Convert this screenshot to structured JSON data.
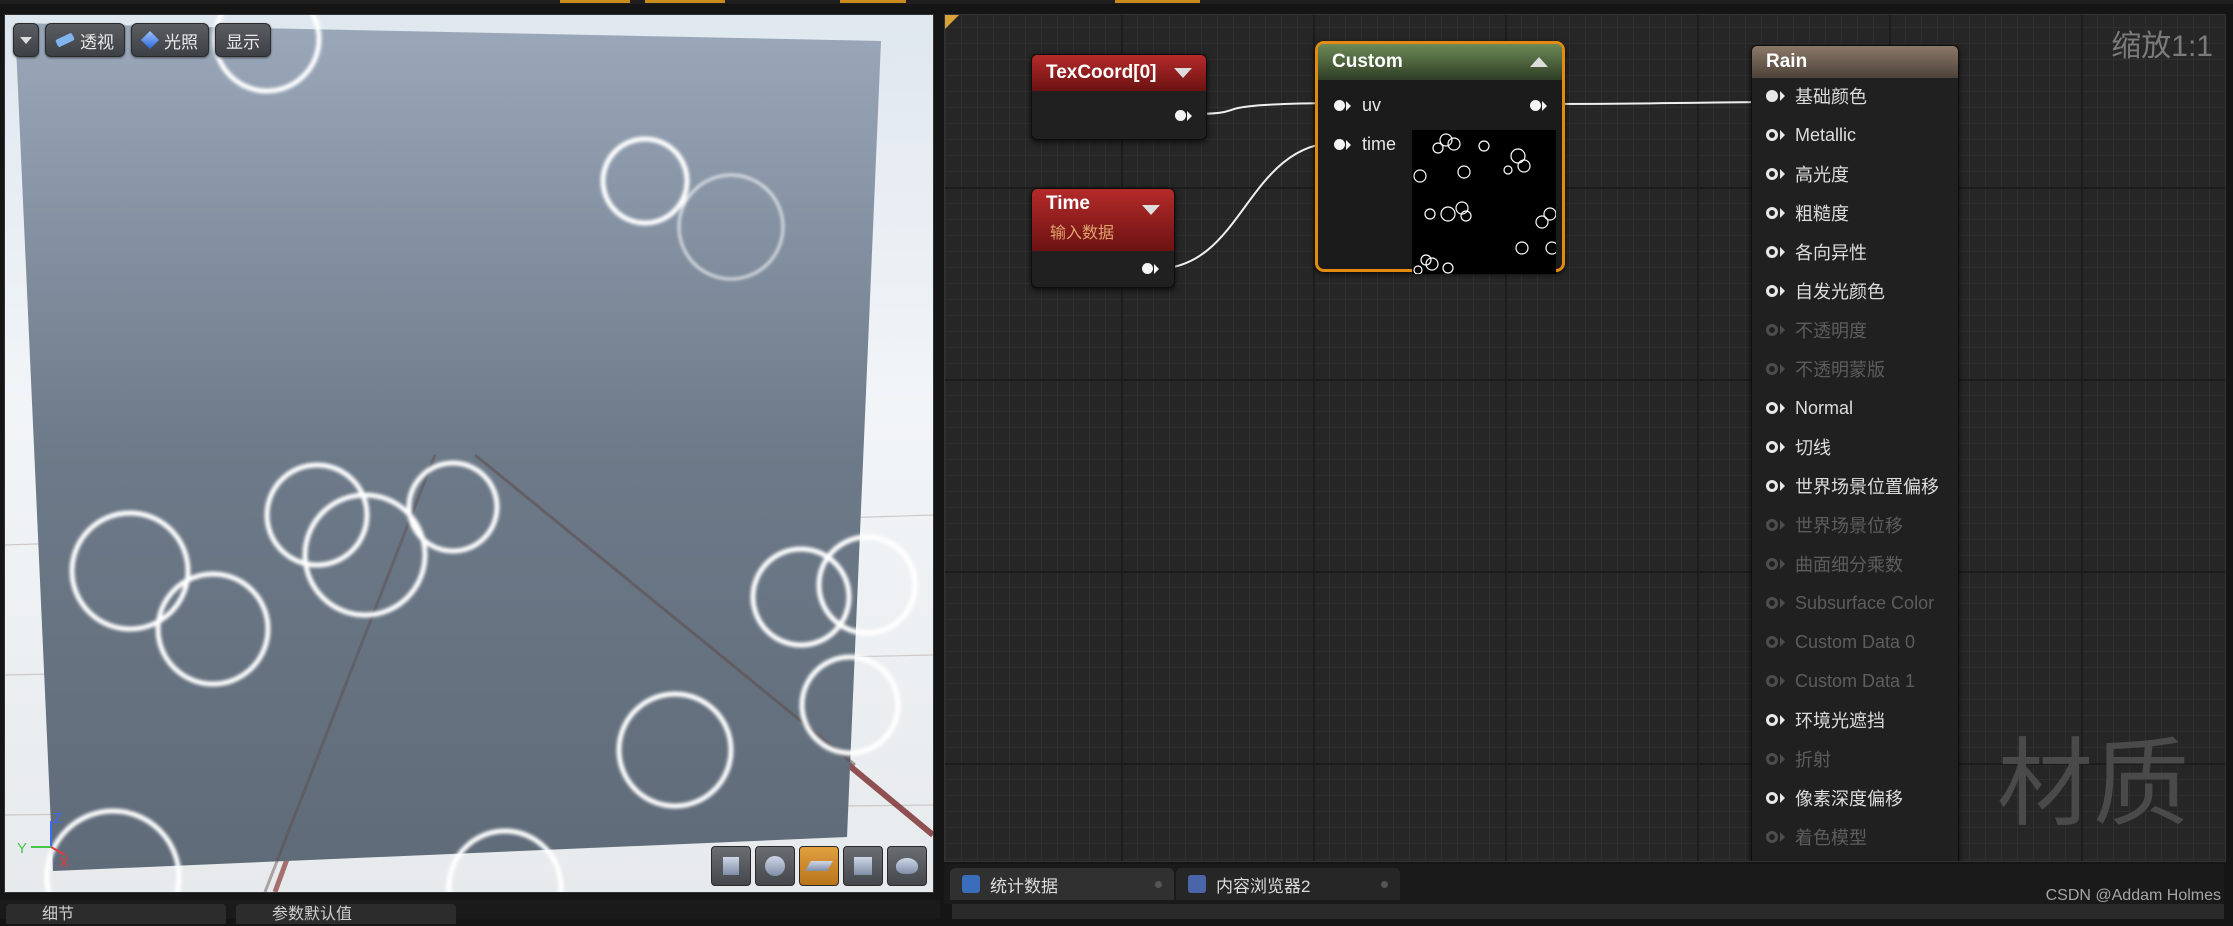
{
  "viewport": {
    "toolbar": {
      "perspective": "透视",
      "lighting": "光照",
      "show": "显示"
    },
    "axis": {
      "z": "Z",
      "y": "Y",
      "x": "X"
    },
    "preview_buttons": [
      "cylinder-icon",
      "sphere-icon",
      "plane-icon",
      "cube-icon",
      "teapot-icon"
    ],
    "active_preview": "plane-icon"
  },
  "graph": {
    "zoom": "缩放1:1",
    "watermark": "材质",
    "nodes": {
      "texcoord": {
        "title": "TexCoord[0]"
      },
      "time": {
        "title": "Time",
        "subtitle": "输入数据"
      },
      "custom": {
        "title": "Custom",
        "inputs": [
          "uv",
          "time"
        ]
      },
      "rain": {
        "title": "Rain",
        "pins": [
          {
            "label": "基础颜色",
            "enabled": true,
            "connected": true
          },
          {
            "label": "Metallic",
            "enabled": true,
            "connected": false
          },
          {
            "label": "高光度",
            "enabled": true,
            "connected": false
          },
          {
            "label": "粗糙度",
            "enabled": true,
            "connected": false
          },
          {
            "label": "各向异性",
            "enabled": true,
            "connected": false
          },
          {
            "label": "自发光颜色",
            "enabled": true,
            "connected": false
          },
          {
            "label": "不透明度",
            "enabled": false,
            "connected": false
          },
          {
            "label": "不透明蒙版",
            "enabled": false,
            "connected": false
          },
          {
            "label": "Normal",
            "enabled": true,
            "connected": false
          },
          {
            "label": "切线",
            "enabled": true,
            "connected": false
          },
          {
            "label": "世界场景位置偏移",
            "enabled": true,
            "connected": false
          },
          {
            "label": "世界场景位移",
            "enabled": false,
            "connected": false
          },
          {
            "label": "曲面细分乘数",
            "enabled": false,
            "connected": false
          },
          {
            "label": "Subsurface Color",
            "enabled": false,
            "connected": false
          },
          {
            "label": "Custom Data 0",
            "enabled": false,
            "connected": false
          },
          {
            "label": "Custom Data 1",
            "enabled": false,
            "connected": false
          },
          {
            "label": "环境光遮挡",
            "enabled": true,
            "connected": false
          },
          {
            "label": "折射",
            "enabled": false,
            "connected": false
          },
          {
            "label": "像素深度偏移",
            "enabled": true,
            "connected": false
          },
          {
            "label": "着色模型",
            "enabled": false,
            "connected": false
          }
        ]
      }
    },
    "colors": {
      "selection": "#e38a0f",
      "param_header": "#b52a2a",
      "custom_header": "#6d8a57",
      "result_header": "#8a7868"
    }
  },
  "tabs": {
    "stats": "统计数据",
    "content_browser": "内容浏览器2"
  },
  "bottom_left_tabs": {
    "details": "细节",
    "param_defaults": "参数默认值"
  },
  "credit": "CSDN @Addam Holmes"
}
